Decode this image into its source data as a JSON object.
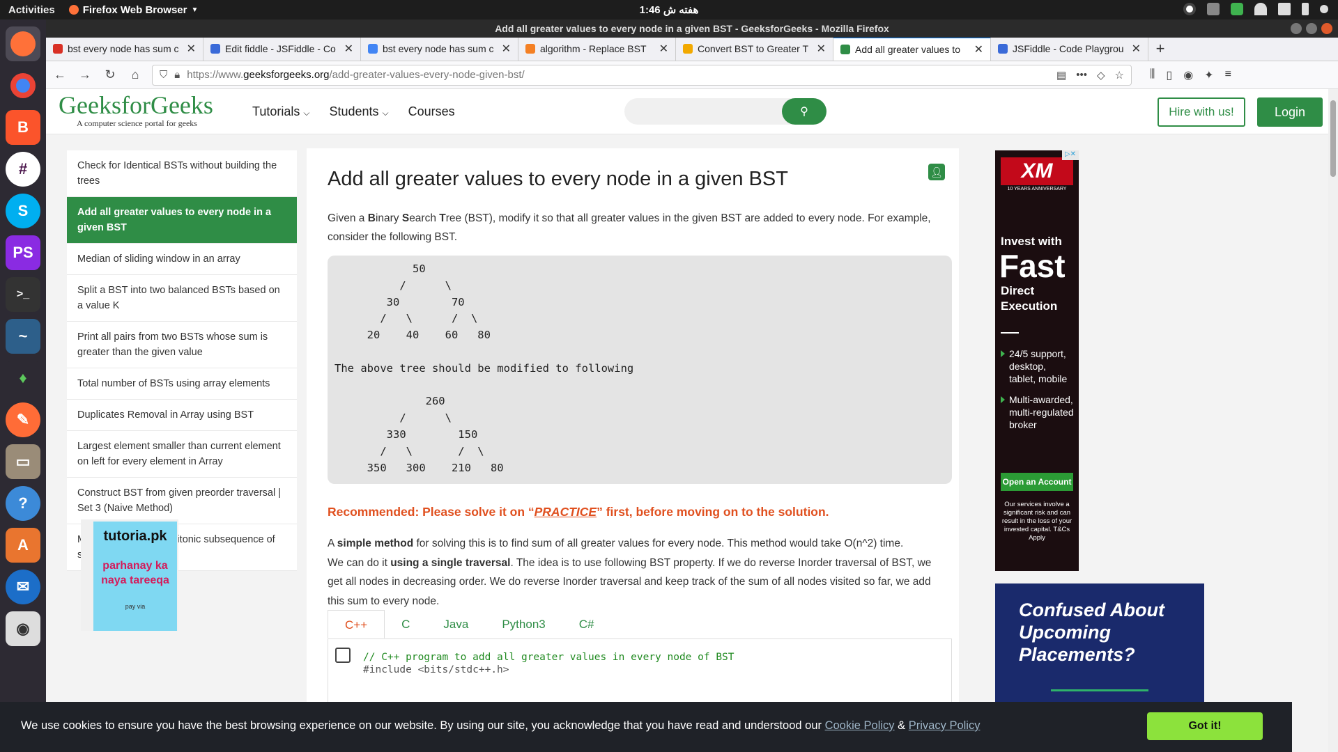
{
  "os": {
    "activities": "Activities",
    "app_name": "Firefox Web Browser",
    "clock": "1:46 هفته ش"
  },
  "window": {
    "title": "Add all greater values to every node in a given BST - GeeksforGeeks - Mozilla Firefox"
  },
  "tabs": [
    {
      "label": "bst every node has sum c",
      "color": "#d93025"
    },
    {
      "label": "Edit fiddle - JSFiddle - Co",
      "color": "#3a6ad8"
    },
    {
      "label": "bst every node has sum c",
      "color": "#4285f4"
    },
    {
      "label": "algorithm - Replace BST",
      "color": "#f48024"
    },
    {
      "label": "Convert BST to Greater T",
      "color": "#f2a900"
    },
    {
      "label": "Add all greater values to",
      "color": "#2f8d46"
    },
    {
      "label": "JSFiddle - Code Playgrou",
      "color": "#3a6ad8"
    }
  ],
  "address": {
    "scheme": "https://www.",
    "domain": "geeksforgeeks.org",
    "path": "/add-greater-values-every-node-given-bst/"
  },
  "site": {
    "logo": "GeeksforGeeks",
    "tagline": "A computer science portal for geeks",
    "menu": [
      "Tutorials",
      "Students",
      "Courses"
    ],
    "hire": "Hire with us!",
    "login": "Login"
  },
  "sidebar": [
    "Check for Identical BSTs without building the trees",
    "Add all greater values to every node in a given BST",
    "Median of sliding window in an array",
    "Split a BST into two balanced BSTs based on a value K",
    "Print all pairs from two BSTs whose sum is greater than the given value",
    "Total number of BSTs using array elements",
    "Duplicates Removal in Array using BST",
    "Largest element smaller than current element on left for every element in Array",
    "Construct BST from given preorder traversal | Set 3 (Naive Method)",
    "Maximum product of bitonic subsequence of size 3"
  ],
  "ad_left": {
    "brand": "tutoria.pk",
    "line1": "parhanay ka",
    "line2": "naya tareeqa",
    "small": "pay via"
  },
  "article": {
    "title": "Add all greater values to every node in a given BST",
    "intro_a": "Given a ",
    "intro_b": "B",
    "intro_c": "inary ",
    "intro_d": "S",
    "intro_e": "earch ",
    "intro_f": "T",
    "intro_g": "ree (BST), modify it so that all greater values in the given BST are added to every node. For example, consider the following BST.",
    "pre": "            50\n          /      \\\n        30        70\n       /   \\      /  \\\n     20    40    60   80\n\nThe above tree should be modified to following\n\n              260\n          /      \\\n        330        150\n       /   \\       /  \\\n     350   300    210   80",
    "rec_prefix": "Recommended: Please solve it on “",
    "rec_link": "PRACTICE",
    "rec_suffix": "” first, before moving on to the solution.",
    "p2_a": "A ",
    "p2_b": "simple method",
    "p2_c": " for solving this is to find sum of all greater values for every node. This method would take O(n^2) time.",
    "p2_d": "We can do it ",
    "p2_e": "using a single traversal",
    "p2_f": ". The idea is to use following BST property. If we do reverse Inorder traversal of BST, we get all nodes in decreasing order. We do reverse Inorder traversal and keep track of the sum of all nodes visited so far, we add this sum to every node.",
    "code_tabs": [
      "C++",
      "C",
      "Java",
      "Python3",
      "C#"
    ],
    "code_line1": "// C++ program to add all greater values in every node of BST",
    "code_line2": "#include <bits/stdc++.h>"
  },
  "ad_xm": {
    "logo": "XM",
    "anniv": "10 YEARS ANNIVERSARY",
    "invest": "Invest with",
    "fast": "Fast",
    "direct": "Direct",
    "execution": "Execution",
    "b1": "24/5 support, desktop, tablet, mobile",
    "b2": "Multi-awarded, multi-regulated broker",
    "cta": "Open an Account",
    "disc": "Our services involve a significant risk and can result in the loss of your invested capital. T&Cs Apply"
  },
  "ad_placement": {
    "text": "Confused About Upcoming Placements?"
  },
  "cookie": {
    "msg": "We use cookies to ensure you have the best browsing experience on our website. By using our site, you acknowledge that you have read and understood our",
    "policy": "Cookie Policy",
    "amp": "&",
    "privacy": "Privacy Policy",
    "btn": "Got it!"
  }
}
